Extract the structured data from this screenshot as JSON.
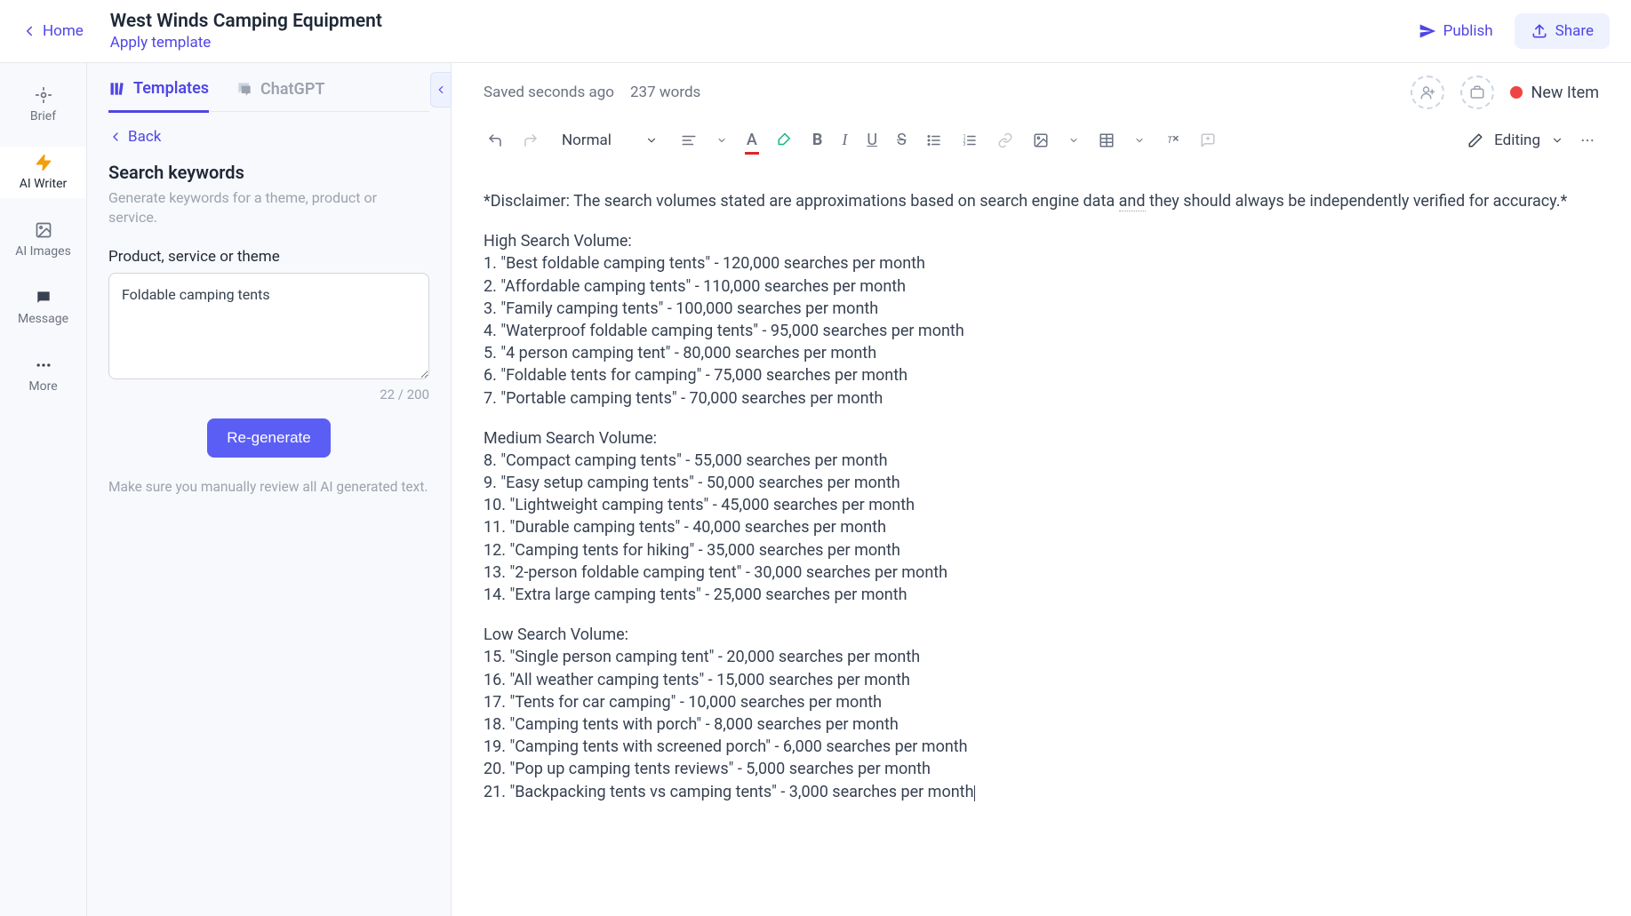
{
  "header": {
    "home": "Home",
    "title": "West Winds Camping Equipment",
    "apply_template": "Apply template",
    "publish": "Publish",
    "share": "Share"
  },
  "rail": {
    "brief": "Brief",
    "ai_writer": "AI Writer",
    "ai_images": "AI Images",
    "message": "Message",
    "more": "More"
  },
  "sidebar": {
    "tabs": {
      "templates": "Templates",
      "chatgpt": "ChatGPT"
    },
    "back": "Back",
    "panel_title": "Search keywords",
    "panel_desc": "Generate keywords for a theme, product or service.",
    "field_label": "Product, service or theme",
    "input_value": "Foldable camping tents",
    "char_count": "22 / 200",
    "regenerate": "Re-generate",
    "review_note": "Make sure you manually review all AI generated text."
  },
  "editor": {
    "save_status": "Saved seconds ago",
    "word_count": "237 words",
    "new_item": "New Item",
    "style": "Normal",
    "editing": "Editing"
  },
  "content": {
    "disclaimer_a": "*Disclaimer: The search volumes stated are approximations based on search engine data ",
    "disclaimer_and": "and",
    "disclaimer_b": " they should always be independently verified for accuracy.*",
    "high_header": "High Search Volume:",
    "high": [
      "1. \"Best foldable camping tents\" - 120,000 searches per month",
      "2. \"Affordable camping tents\" - 110,000 searches per month",
      "3. \"Family camping tents\" - 100,000 searches per month",
      "4. \"Waterproof foldable camping tents\" - 95,000 searches per month",
      "5. \"4 person camping tent\" - 80,000 searches per month",
      "6. \"Foldable tents for camping\" - 75,000 searches per month",
      "7. \"Portable camping tents\" - 70,000 searches per month"
    ],
    "medium_header": "Medium Search Volume:",
    "medium": [
      "8. \"Compact camping tents\" - 55,000 searches per month",
      "9. \"Easy setup camping tents\" - 50,000 searches per month",
      "10. \"Lightweight camping tents\" - 45,000 searches per month",
      "11. \"Durable camping tents\" - 40,000 searches per month",
      "12. \"Camping tents for hiking\" - 35,000 searches per month",
      "13. \"2-person foldable camping tent\" - 30,000 searches per month",
      "14. \"Extra large camping tents\" - 25,000 searches per month"
    ],
    "low_header": "Low Search Volume:",
    "low": [
      "15. \"Single person camping tent\" - 20,000 searches per month",
      "16. \"All weather camping tents\" - 15,000 searches per month",
      "17. \"Tents for car camping\" - 10,000 searches per month",
      "18. \"Camping tents with porch\" - 8,000 searches per month",
      "19. \"Camping tents with screened porch\" - 6,000 searches per month",
      "20. \"Pop up camping tents reviews\" - 5,000 searches per month",
      "21. \"Backpacking tents vs camping tents\" - 3,000 searches per month"
    ]
  }
}
